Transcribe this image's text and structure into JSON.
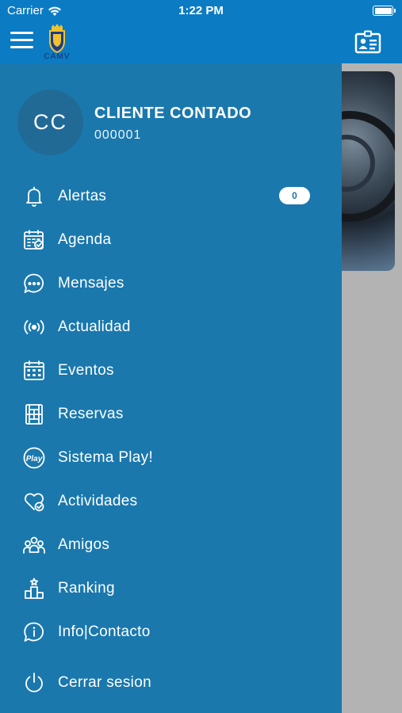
{
  "status_bar": {
    "carrier": "Carrier",
    "time": "1:22 PM"
  },
  "app_bar": {
    "logo_text": "CAMV"
  },
  "user": {
    "initials": "CC",
    "name": "CLIENTE CONTADO",
    "id": "000001"
  },
  "menu": {
    "items": [
      {
        "label": "Alertas",
        "icon": "bell-icon",
        "badge": "0"
      },
      {
        "label": "Agenda",
        "icon": "calendar-check-icon"
      },
      {
        "label": "Mensajes",
        "icon": "chat-bubble-icon"
      },
      {
        "label": "Actualidad",
        "icon": "broadcast-icon"
      },
      {
        "label": "Eventos",
        "icon": "calendar-grid-icon"
      },
      {
        "label": "Reservas",
        "icon": "court-icon"
      },
      {
        "label": "Sistema Play!",
        "icon": "play-logo-icon"
      },
      {
        "label": "Actividades",
        "icon": "heart-check-icon"
      },
      {
        "label": "Amigos",
        "icon": "group-icon"
      },
      {
        "label": "Ranking",
        "icon": "podium-icon"
      },
      {
        "label": "Info|Contacto",
        "icon": "info-icon"
      },
      {
        "label": "Cerrar sesion",
        "icon": "power-icon"
      }
    ]
  },
  "colors": {
    "primary": "#0b7bc4",
    "drawer": "#1a78ad",
    "avatar": "#226a96",
    "overlay": "#b3b3b3"
  }
}
